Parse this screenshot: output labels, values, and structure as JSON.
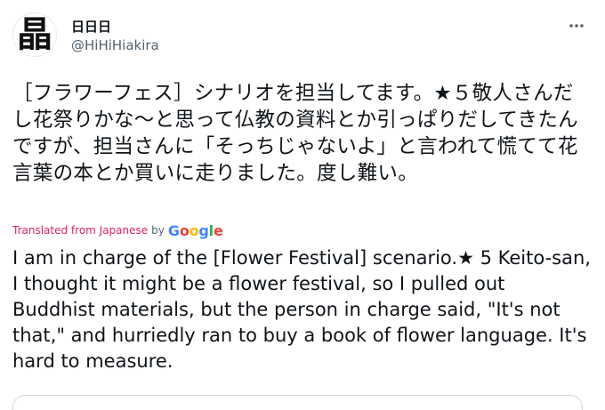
{
  "tweet": {
    "avatar_text": "晶",
    "display_name": "日日日",
    "handle": "@HiHiHiakira",
    "text_ja": "［フラワーフェス］シナリオを担当してます。★５敬人さんだし花祭りかな〜と思って仏教の資料とか引っぱりだしてきたんですが、担当さんに「そっちじゃないよ」と言われて慌てて花言葉の本とか買いに走りました。度し難い。",
    "translated_label": "Translated from Japanese",
    "translated_by": "by",
    "translator": "Google",
    "translator_letters": [
      "G",
      "o",
      "o",
      "g",
      "l",
      "e"
    ],
    "translator_colors": [
      "#4285F4",
      "#EA4335",
      "#FBBC05",
      "#4285F4",
      "#34A853",
      "#EA4335"
    ],
    "text_en": "I am in charge of the [Flower Festival] scenario.★ 5 Keito-san, I thought it might be a flower festival, so I pulled out Buddhist materials, but the person in charge said, \"It's not that,\" and hurriedly ran to buy a book of flower language. It's hard to measure."
  },
  "icons": {
    "more": "more-horizontal-icon"
  },
  "colors": {
    "text": "#0f1419",
    "secondary": "#536471",
    "translated": "#e0245e",
    "border": "#cfd9de"
  }
}
